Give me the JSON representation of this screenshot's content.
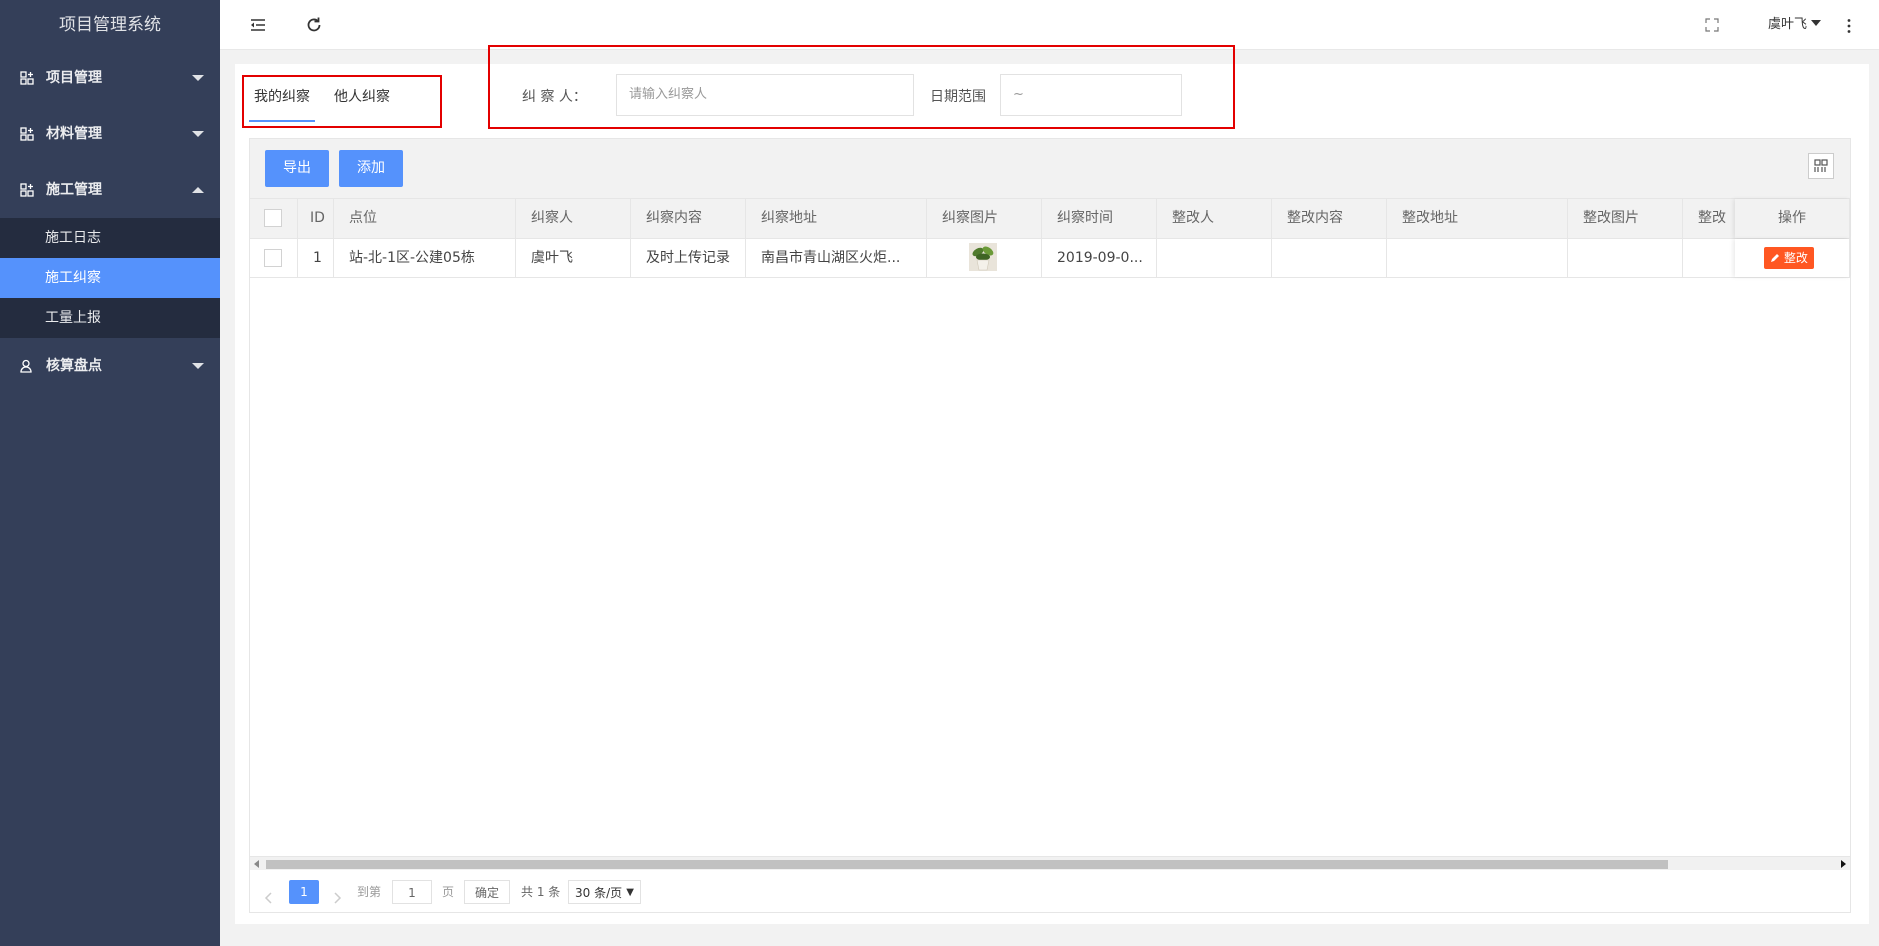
{
  "app": {
    "title": "项目管理系统"
  },
  "sidebar": {
    "items": [
      {
        "label": "项目管理"
      },
      {
        "label": "材料管理"
      },
      {
        "label": "施工管理"
      },
      {
        "label": "核算盘点"
      }
    ],
    "submenu": [
      {
        "label": "施工日志"
      },
      {
        "label": "施工纠察"
      },
      {
        "label": "工量上报"
      }
    ]
  },
  "header": {
    "user_name": "虞叶飞"
  },
  "tabs": [
    {
      "label": "我的纠察"
    },
    {
      "label": "他人纠察"
    }
  ],
  "filters": {
    "inspector_label": "纠 察 人：",
    "inspector_placeholder": "请输入纠察人",
    "date_label": "日期范围",
    "date_value": "~"
  },
  "toolbar": {
    "export_label": "导出",
    "add_label": "添加"
  },
  "table": {
    "columns": [
      "ID",
      "点位",
      "纠察人",
      "纠察内容",
      "纠察地址",
      "纠察图片",
      "纠察时间",
      "整改人",
      "整改内容",
      "整改地址",
      "整改图片",
      "整改",
      "操作"
    ],
    "rows": [
      {
        "id": "1",
        "location": "站-北-1区-公建05栋",
        "inspector": "虞叶飞",
        "content": "及时上传记录",
        "address": "南昌市青山湖区火炬...",
        "time": "2019-09-0...",
        "action": "整改"
      }
    ]
  },
  "pagination": {
    "current_page": "1",
    "goto_label": "到第",
    "page_input": "1",
    "page_unit": "页",
    "confirm_label": "确定",
    "total_label": "共 1 条",
    "page_size": "30 条/页"
  },
  "colors": {
    "sidebar": "#343f59",
    "accent": "#5592fc",
    "danger": "#ff5722",
    "highlight_box": "#e30000"
  }
}
